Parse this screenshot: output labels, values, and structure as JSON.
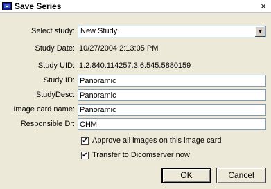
{
  "window": {
    "title": "Save Series",
    "close_glyph": "×"
  },
  "form": {
    "select_study": {
      "label": "Select study:",
      "value": "New Study"
    },
    "study_date": {
      "label": "Study Date:",
      "value": "10/27/2004 2:13:05 PM"
    },
    "study_uid": {
      "label": "Study UID:",
      "value": "1.2.840.114257.3.6.545.5880159"
    },
    "study_id": {
      "label": "Study ID:",
      "value": "Panoramic"
    },
    "study_desc": {
      "label": "StudyDesc:",
      "value": "Panoramic"
    },
    "image_card_name": {
      "label": "Image card name:",
      "value": "Panoramic"
    },
    "responsible_dr": {
      "label": "Responsible Dr:",
      "value": "CHM"
    }
  },
  "options": {
    "approve_all": {
      "label": "Approve all images on this image card",
      "checked": true
    },
    "transfer": {
      "label": "Transfer to Dicomserver now",
      "checked": true
    }
  },
  "buttons": {
    "ok": "OK",
    "cancel": "Cancel"
  },
  "icons": {
    "app": "save-series-app-icon",
    "dropdown": "chevron-down-icon",
    "check": "checkmark-icon"
  }
}
